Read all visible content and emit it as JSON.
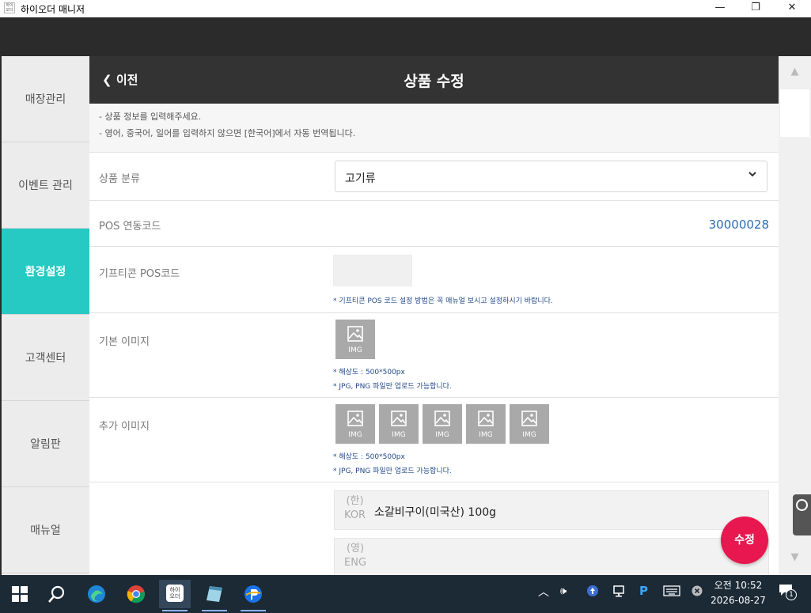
{
  "window": {
    "title": "하이오더 매니저",
    "app_icon_text": "하이오더",
    "minimize": "—",
    "maximize": "❐",
    "close": "✕"
  },
  "sidebar": {
    "items": [
      {
        "label": "매장관리"
      },
      {
        "label": "이벤트 관리"
      },
      {
        "label": "환경설정",
        "active": true
      },
      {
        "label": "고객센터"
      },
      {
        "label": "알림판"
      },
      {
        "label": "매뉴얼"
      }
    ]
  },
  "header": {
    "back_label": "이전",
    "title": "상품 수정"
  },
  "notice": {
    "line1": "-  상품 정보를 입력해주세요.",
    "line2": "-  영어, 중국어, 일어를 입력하지 않으면 [한국어]에서 자동 번역됩니다."
  },
  "form": {
    "category_label": "상품 분류",
    "category_value": "고기류",
    "pos_code_label": "POS 연동코드",
    "pos_code_value": "30000028",
    "gifticon_label": "기프티콘 POS코드",
    "gifticon_note": "* 기프티콘 POS 코드 설정 방법은 꼭 매뉴얼 보시고 설정하시기 바랍니다.",
    "base_image_label": "기본 이미지",
    "extra_image_label": "추가 이미지",
    "img_text": "IMG",
    "resolution_note": "* 해상도 : 500*500px",
    "format_note": "* JPG, PNG 파일만 업로드 가능합니다.",
    "names": [
      {
        "lang_local": "(한)",
        "lang_code": "KOR",
        "value": "소갈비구이(미국산) 100g"
      },
      {
        "lang_local": "(영)",
        "lang_code": "ENG",
        "value": ""
      }
    ]
  },
  "submit_label": "수정",
  "taskbar": {
    "ime": "P",
    "clock_period_time": "오전 10:52",
    "clock_date": "2026-08-27",
    "notification_count": "1",
    "hiorder_icon_text": "하이\n오더"
  },
  "colors": {
    "accent": "#27c9c3",
    "header_dark": "#333333",
    "submit": "#e8174f",
    "link_blue": "#2a6db5"
  }
}
